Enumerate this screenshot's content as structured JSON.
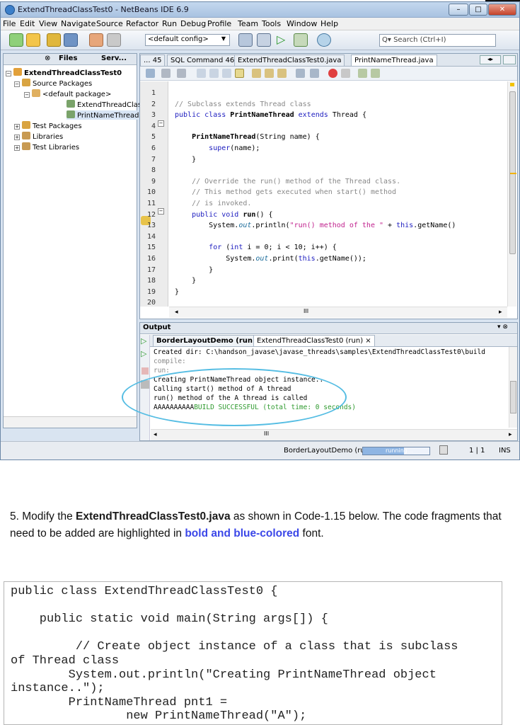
{
  "window": {
    "title": "ExtendThreadClassTest0 - NetBeans IDE 6.9",
    "min": "–",
    "max": "□",
    "close": "✕"
  },
  "menu": [
    "File",
    "Edit",
    "View",
    "Navigate",
    "Source",
    "Refactor",
    "Run",
    "Debug",
    "Profile",
    "Team",
    "Tools",
    "Window",
    "Help"
  ],
  "toolbar": {
    "config": "<default config>",
    "search_placeholder": "Search (Ctrl+I)",
    "search_prefix": "Q▾"
  },
  "left_panel": {
    "tabs": [
      "⊗",
      "Files",
      "Serv..."
    ],
    "tree": [
      "ExtendThreadClassTest0",
      "Source Packages",
      "<default package>",
      "ExtendThreadClass",
      "PrintNameThread.j",
      "Test Packages",
      "Libraries",
      "Test Libraries"
    ]
  },
  "editor": {
    "tabs": [
      "... 45",
      "SQL Command 46",
      "ExtendThreadClassTest0.java",
      "PrintNameThread.java"
    ],
    "line_numbers": [
      "1",
      "2",
      "3",
      "4",
      "5",
      "6",
      "7",
      "8",
      "9",
      "10",
      "11",
      "12",
      "13",
      "14",
      "15",
      "16",
      "17",
      "18",
      "19",
      "20"
    ],
    "lines": [
      "",
      "// Subclass extends Thread class",
      "public class PrintNameThread extends Thread {",
      "",
      "    PrintNameThread(String name) {",
      "        super(name);",
      "    }",
      "",
      "    // Override the run() method of the Thread class.",
      "    // This method gets executed when start() method",
      "    // is invoked.",
      "    public void run() {",
      "        System.out.println(\"run() method of the \" + this.getName()",
      "",
      "        for (int i = 0; i < 10; i++) {",
      "            System.out.print(this.getName());",
      "        }",
      "    }",
      "}",
      ""
    ],
    "hscroll_mark": "III"
  },
  "output": {
    "title": "Output",
    "tabs": [
      "BorderLayoutDemo (run)",
      "ExtendThreadClassTest0 (run)"
    ],
    "lines": [
      "Created dir: C:\\handson_javase\\javase_threads\\samples\\ExtendThreadClassTest0\\build",
      "compile:",
      "run:",
      "Creating PrintNameThread object instance..",
      "Calling start() method of A thread",
      "run() method of the A thread is called",
      "AAAAAAAAAA",
      "BUILD SUCCESSFUL (total time: 0 seconds)"
    ],
    "hscroll_mark": "III"
  },
  "statusbar": {
    "task": "BorderLayoutDemo (run)",
    "progress_label": "running...",
    "progress": 0.62,
    "position": "1 | 1",
    "mode": "INS"
  },
  "instruction": {
    "step": "5. Modify the ",
    "file": "ExtendThreadClassTest0.java",
    "mid": " as shown in Code-1.15 below. The code fragments that need to be added are highlighted in ",
    "highlight": "bold and blue-colored",
    "end": " font."
  },
  "code_listing": [
    "public class ExtendThreadClassTest0 {",
    "",
    "    public static void main(String args[]) {",
    "",
    "         // Create object instance of a class that is subclass",
    "of Thread class",
    "        System.out.println(\"Creating PrintNameThread object",
    "instance..\");",
    "        PrintNameThread pnt1 =",
    "                new PrintNameThread(\"A\");"
  ]
}
